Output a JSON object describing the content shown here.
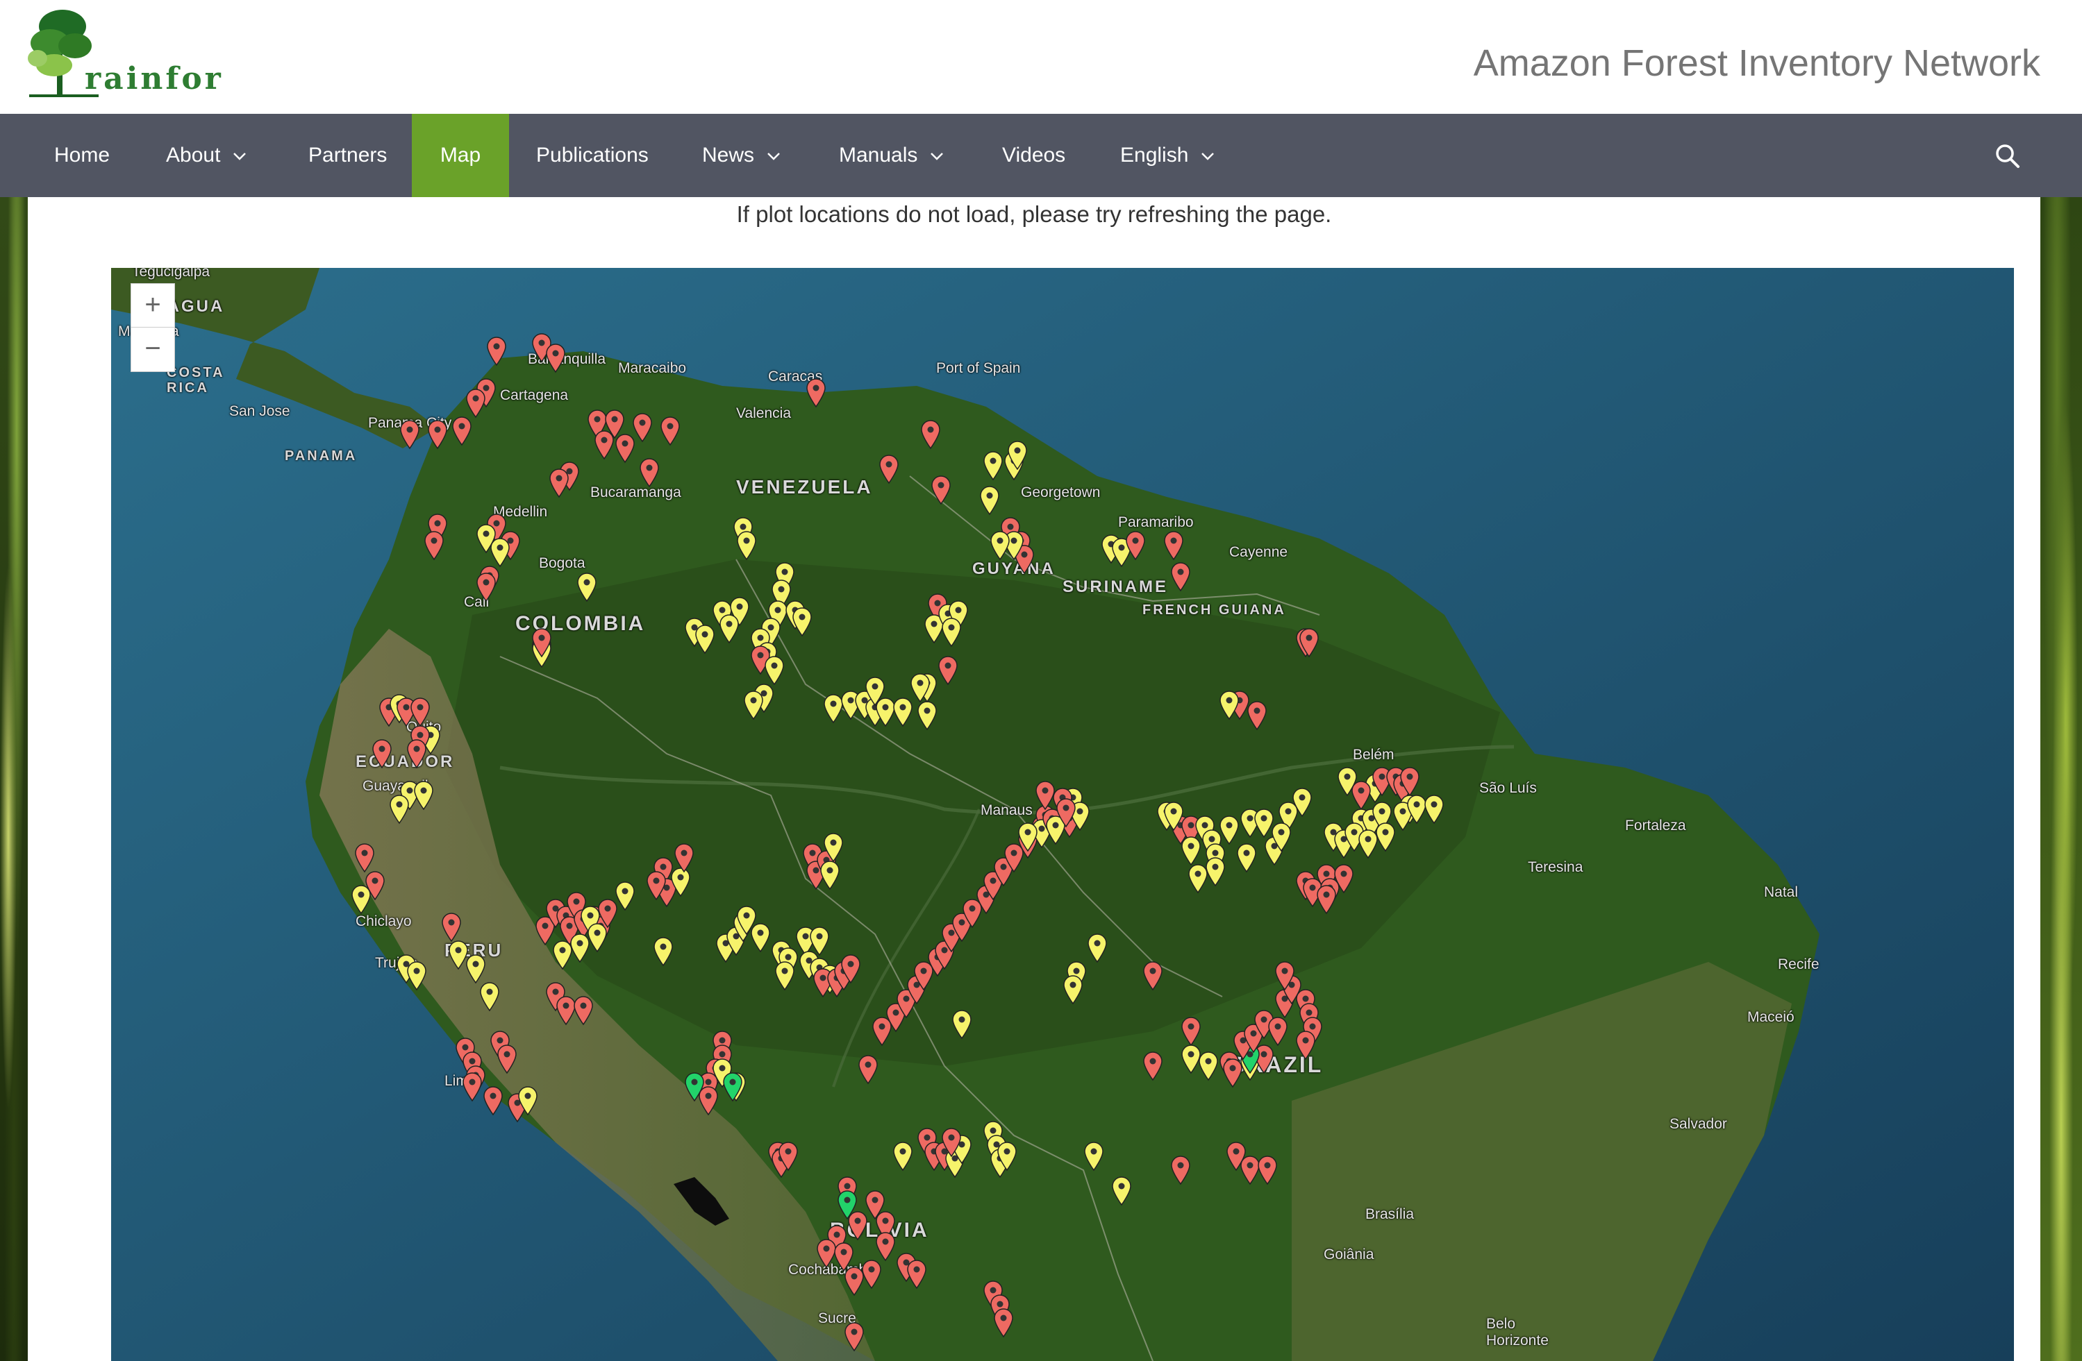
{
  "header": {
    "logo_text": "rainfor",
    "site_title": "Amazon Forest Inventory Network"
  },
  "nav": {
    "items": [
      {
        "label": "Home",
        "dropdown": false
      },
      {
        "label": "About",
        "dropdown": true
      },
      {
        "label": "Partners",
        "dropdown": false
      },
      {
        "label": "Map",
        "dropdown": false,
        "active": true
      },
      {
        "label": "Publications",
        "dropdown": false
      },
      {
        "label": "News",
        "dropdown": true
      },
      {
        "label": "Manuals",
        "dropdown": true
      },
      {
        "label": "Videos",
        "dropdown": false
      },
      {
        "label": "English",
        "dropdown": true
      }
    ],
    "active_color": "#6aa229",
    "bar_color": "#515562"
  },
  "notice": "If plot locations do not load, please try refreshing the page.",
  "map": {
    "zoom_in": "+",
    "zoom_out": "−",
    "labels": {
      "tegucigalpa": "Tegucigalpa",
      "managua": "Managua",
      "nicaragua": "ARAGUA",
      "costa_rica": "COSTA RICA",
      "san_jose": "San Jose",
      "panama_city": "Panama City",
      "panama": "PANAMA",
      "barranquilla": "Barranquilla",
      "cartagena": "Cartagena",
      "maracaibo": "Maracaibo",
      "caracas": "Caracas",
      "valencia": "Valencia",
      "port_of_spain": "Port of Spain",
      "venezuela": "VENEZUELA",
      "bucaramanga": "Bucaramanga",
      "medellin": "Medellin",
      "georgetown": "Georgetown",
      "paramaribo": "Paramaribo",
      "cayenne": "Cayenne",
      "guyana": "GUYANA",
      "suriname": "SURINAME",
      "french_guiana": "FRENCH GUIANA",
      "bogota": "Bogota",
      "cali": "Cali",
      "colombia": "COLOMBIA",
      "quito": "Quito",
      "ecuador": "ECUADOR",
      "guayaquil": "Guayaquil",
      "manaus": "Manaus",
      "belem": "Belém",
      "sao_luis": "São Luís",
      "fortaleza": "Fortaleza",
      "teresina": "Teresina",
      "natal": "Natal",
      "recife": "Recife",
      "maceio": "Maceió",
      "salvador": "Salvador",
      "chiclayo": "Chiclayo",
      "trujillo": "Trujillo",
      "peru": "PERU",
      "lima": "Lima",
      "brazil": "BRAZIL",
      "bolivia": "BOLIVIA",
      "cochabamba": "Cochabamba",
      "sucre": "Sucre",
      "brasilia": "Brasília",
      "goiania": "Goiânia",
      "belo_horizonte": "Belo Horizonte"
    },
    "marker_colors": {
      "red": "#ee6a62",
      "yellow": "#f6f36b",
      "green": "#22d36a"
    }
  }
}
